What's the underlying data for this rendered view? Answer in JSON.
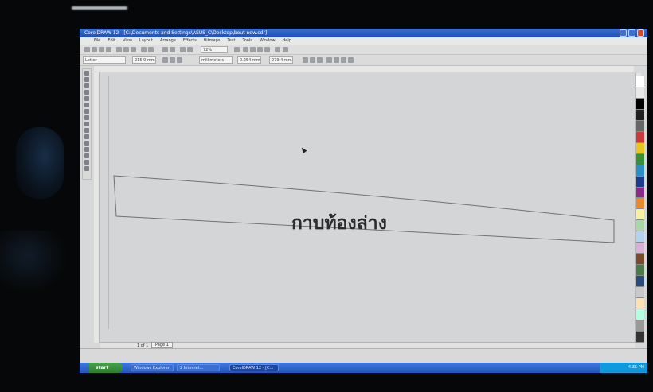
{
  "window": {
    "title": "CorelDRAW 12 - [C:\\Documents and Settings\\ASUS_C\\Desktop\\bout new.cdr]"
  },
  "menu": [
    "File",
    "Edit",
    "View",
    "Layout",
    "Arrange",
    "Effects",
    "Bitmaps",
    "Text",
    "Tools",
    "Window",
    "Help"
  ],
  "toolbar": {
    "zoom_value": "72%",
    "font_name": "Letter",
    "page_width": "215.9 mm",
    "page_height": "279.4 mm",
    "units": "millimeters",
    "nudge": "0.254 mm"
  },
  "canvas": {
    "caption_text": "กาบท้องล่าง"
  },
  "page_nav": {
    "counter": "1 of 1",
    "tab_label": "Page 1"
  },
  "taskbar": {
    "start_label": "start",
    "tasks": [
      "Windows Explorer",
      "2 Internet...",
      "CorelDRAW 12 - [C..."
    ],
    "clock": "4:35 PM"
  },
  "colors": {
    "titlebar": "#1d4fb5",
    "taskbar": "#1f55c0",
    "start_button": "#2e7f2f",
    "canvas_bg": "#d3d5d6",
    "palette": [
      "#ffffff",
      "#e8e8e8",
      "#000000",
      "#202020",
      "#666666",
      "#c93a3a",
      "#e8c51f",
      "#3a8e3a",
      "#2a8fc9",
      "#1b3b8c",
      "#8c2a8c",
      "#e88a2a",
      "#f2f2a0",
      "#a6d9a6",
      "#b0d4f0",
      "#d9b0d9",
      "#7a4a2a",
      "#4a7a4a",
      "#2a4a7a",
      "#c9c9c9",
      "#ffe0b0",
      "#b0ffe0",
      "#999999",
      "#333333"
    ]
  }
}
